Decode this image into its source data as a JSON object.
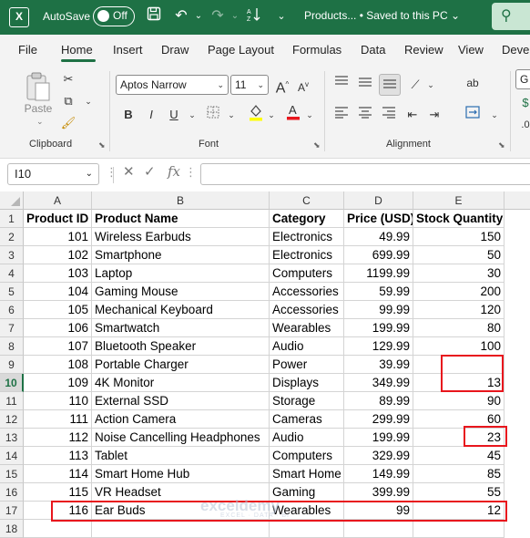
{
  "titlebar": {
    "app_icon": "X",
    "autosave_label": "AutoSave",
    "autosave_state": "Off",
    "doc_title": "Products... • Saved to this PC ⌄"
  },
  "menu": [
    "File",
    "Home",
    "Insert",
    "Draw",
    "Page Layout",
    "Formulas",
    "Data",
    "Review",
    "View",
    "Devel"
  ],
  "ribbon": {
    "clipboard_label": "Clipboard",
    "paste_label": "Paste",
    "font_label": "Font",
    "alignment_label": "Alignment",
    "font_name": "Aptos Narrow",
    "font_size": "11",
    "bold": "B",
    "italic": "I",
    "underline": "U",
    "font_color_a": "A",
    "wrap_label": "ab",
    "number_format_partial": "G"
  },
  "formula_bar": {
    "name_box": "I10",
    "fx": "fx",
    "cancel": "✕",
    "enter": "✓",
    "formula": ""
  },
  "columns": [
    "A",
    "B",
    "C",
    "D",
    "E"
  ],
  "headers": [
    "Product ID",
    "Product Name",
    "Category",
    "Price (USD)",
    "Stock Quantity"
  ],
  "rows": [
    [
      "101",
      "Wireless Earbuds",
      "Electronics",
      "49.99",
      "150"
    ],
    [
      "102",
      "Smartphone",
      "Electronics",
      "699.99",
      "50"
    ],
    [
      "103",
      "Laptop",
      "Computers",
      "1199.99",
      "30"
    ],
    [
      "104",
      "Gaming Mouse",
      "Accessories",
      "59.99",
      "200"
    ],
    [
      "105",
      "Mechanical Keyboard",
      "Accessories",
      "99.99",
      "120"
    ],
    [
      "106",
      "Smartwatch",
      "Wearables",
      "199.99",
      "80"
    ],
    [
      "107",
      "Bluetooth Speaker",
      "Audio",
      "129.99",
      "100"
    ],
    [
      "108",
      "Portable Charger",
      "Power",
      "39.99",
      ""
    ],
    [
      "109",
      "4K Monitor",
      "Displays",
      "349.99",
      "13"
    ],
    [
      "110",
      "External SSD",
      "Storage",
      "89.99",
      "90"
    ],
    [
      "111",
      "Action Camera",
      "Cameras",
      "299.99",
      "60"
    ],
    [
      "112",
      "Noise Cancelling Headphones",
      "Audio",
      "199.99",
      "23"
    ],
    [
      "113",
      "Tablet",
      "Computers",
      "329.99",
      "45"
    ],
    [
      "114",
      "Smart Home Hub",
      "Smart Home",
      "149.99",
      "85"
    ],
    [
      "115",
      "VR Headset",
      "Gaming",
      "399.99",
      "55"
    ],
    [
      "116",
      "Ear Buds",
      "Wearables",
      "99",
      "12"
    ]
  ],
  "row_numbers": [
    "1",
    "2",
    "3",
    "4",
    "5",
    "6",
    "7",
    "8",
    "9",
    "10",
    "11",
    "12",
    "13",
    "14",
    "15",
    "16",
    "17",
    "18"
  ],
  "selected_row": "10",
  "highlight_color": "#e8161d",
  "accent_color": "#1e7145",
  "watermark": {
    "name": "exceldemy",
    "tagline": "EXCEL · DATA · BI"
  }
}
